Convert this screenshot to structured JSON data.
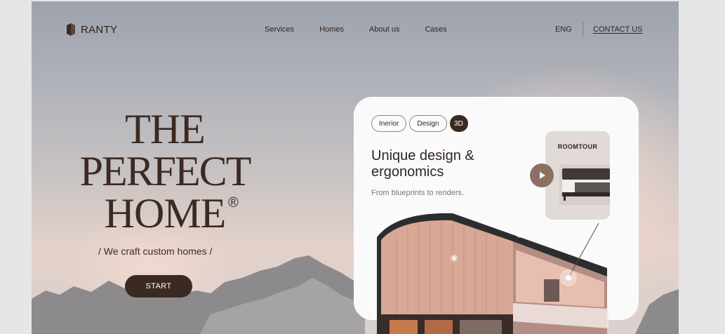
{
  "brand": {
    "name": "RANTY"
  },
  "nav": {
    "items": [
      "Services",
      "Homes",
      "About us",
      "Cases"
    ]
  },
  "header": {
    "lang": "ENG",
    "contact": "CONTACT US"
  },
  "hero": {
    "line1": "THE",
    "line2": "PERFECT",
    "line3": "HOME",
    "reg": "®",
    "tagline": "/ We craft custom homes /",
    "cta": "START"
  },
  "card": {
    "chips": [
      "Inerior",
      "Design",
      "3D"
    ],
    "title_line1": "Unique design &",
    "title_line2": "ergonomics",
    "subtitle": "From blueprints to renders.",
    "roomtour": {
      "label": "ROOMTOUR"
    }
  },
  "icons": {
    "play": "play-icon",
    "logo": "logo-mark-icon"
  },
  "colors": {
    "accent_dark": "#3b2a22",
    "play_bg": "#8b7162",
    "card_bg": "#fbfafa"
  }
}
